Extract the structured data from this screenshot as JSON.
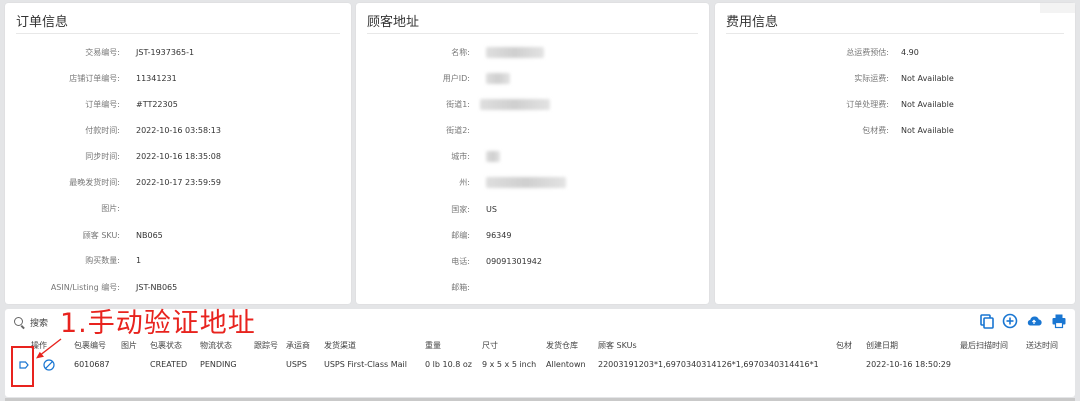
{
  "order": {
    "title": "订单信息",
    "fields": [
      {
        "label": "交易编号:",
        "value": "JST-1937365-1"
      },
      {
        "label": "店铺订单编号:",
        "value": "11341231"
      },
      {
        "label": "订单编号:",
        "value": "#TT22305"
      },
      {
        "label": "付款时间:",
        "value": "2022-10-16 03:58:13"
      },
      {
        "label": "同步时间:",
        "value": "2022-10-16 18:35:08"
      },
      {
        "label": "最晚发货时间:",
        "value": "2022-10-17 23:59:59"
      },
      {
        "label": "图片:",
        "value": ""
      },
      {
        "label": "顾客 SKU:",
        "value": "NB065"
      },
      {
        "label": "购买数量:",
        "value": "1"
      },
      {
        "label": "ASIN/Listing 编号:",
        "value": "JST-NB065"
      }
    ]
  },
  "customer": {
    "title": "顾客地址",
    "fields": [
      {
        "label": "名称:",
        "value": ""
      },
      {
        "label": "用户ID:",
        "value": ""
      },
      {
        "label": "街道1:",
        "value": ""
      },
      {
        "label": "街道2:",
        "value": ""
      },
      {
        "label": "城市:",
        "value": ""
      },
      {
        "label": "州:",
        "value": ""
      },
      {
        "label": "国家:",
        "value": "US"
      },
      {
        "label": "邮编:",
        "value": "96349"
      },
      {
        "label": "电话:",
        "value": "09091301942"
      },
      {
        "label": "邮箱:",
        "value": ""
      }
    ]
  },
  "fee": {
    "title": "费用信息",
    "fields": [
      {
        "label": "总运费预估:",
        "value": "4.90"
      },
      {
        "label": "实际运费:",
        "value": "Not Available"
      },
      {
        "label": "订单处理费:",
        "value": "Not Available"
      },
      {
        "label": "包材费:",
        "value": "Not Available"
      }
    ]
  },
  "toolbar": {
    "search_label": "搜索",
    "annotation": "1.手动验证地址"
  },
  "table": {
    "headers": [
      "操作",
      "包裹编号",
      "图片",
      "包裹状态",
      "物流状态",
      "跟踪号",
      "承运商",
      "发货渠道",
      "重量",
      "尺寸",
      "发货仓库",
      "顾客 SKUs",
      "包材",
      "创建日期",
      "最后扫描时间",
      "送达时间"
    ],
    "row": {
      "package_no": "6010687",
      "package_status": "CREATED",
      "logistics_status": "PENDING",
      "carrier": "USPS",
      "channel": "USPS First-Class Mail",
      "weight": "0 lb 10.8 oz",
      "size": "9 x 5 x 5 inch",
      "warehouse": "Allentown",
      "skus": "22003191203*1,6970340314126*1,6970340314416*1",
      "created": "2022-10-16 18:50:29"
    }
  },
  "colors": {
    "accent": "#1976d2",
    "annotation": "#e8231e"
  }
}
